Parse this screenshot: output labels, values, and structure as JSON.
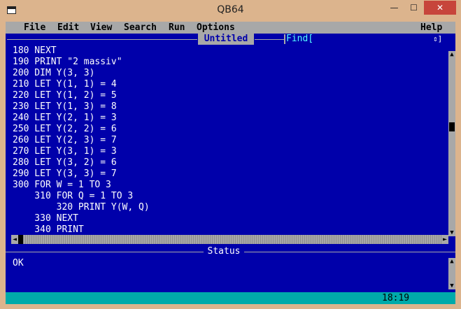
{
  "window": {
    "title": "QB64",
    "minimize_glyph": "—",
    "maximize_glyph": "☐",
    "close_glyph": "✕"
  },
  "menu": [
    "File",
    "Edit",
    "View",
    "Search",
    "Run",
    "Options",
    "Help"
  ],
  "editor": {
    "tab_title": "Untitled",
    "find_label": "Find[",
    "find_arrows": "⇕]",
    "code_lines": [
      "180 NEXT",
      "190 PRINT \"2 massiv\"",
      "200 DIM Y(3, 3)",
      "210 LET Y(1, 1) = 4",
      "220 LET Y(1, 2) = 5",
      "230 LET Y(1, 3) = 8",
      "240 LET Y(2, 1) = 3",
      "250 LET Y(2, 2) = 6",
      "260 LET Y(2, 3) = 7",
      "270 LET Y(3, 1) = 3",
      "280 LET Y(3, 2) = 6",
      "290 LET Y(3, 3) = 7",
      "300 FOR W = 1 TO 3",
      "    310 FOR Q = 1 TO 3",
      "        320 PRINT Y(W, Q)",
      "    330 NEXT",
      "    340 PRINT"
    ]
  },
  "status": {
    "label": "Status",
    "text": "OK"
  },
  "bottom": {
    "time": "18:19"
  },
  "colors": {
    "editor_bg": "#0000aa",
    "menu_bg": "#a8a8a8",
    "bottom_bar": "#00aaaa",
    "find_text": "#55ffff"
  }
}
